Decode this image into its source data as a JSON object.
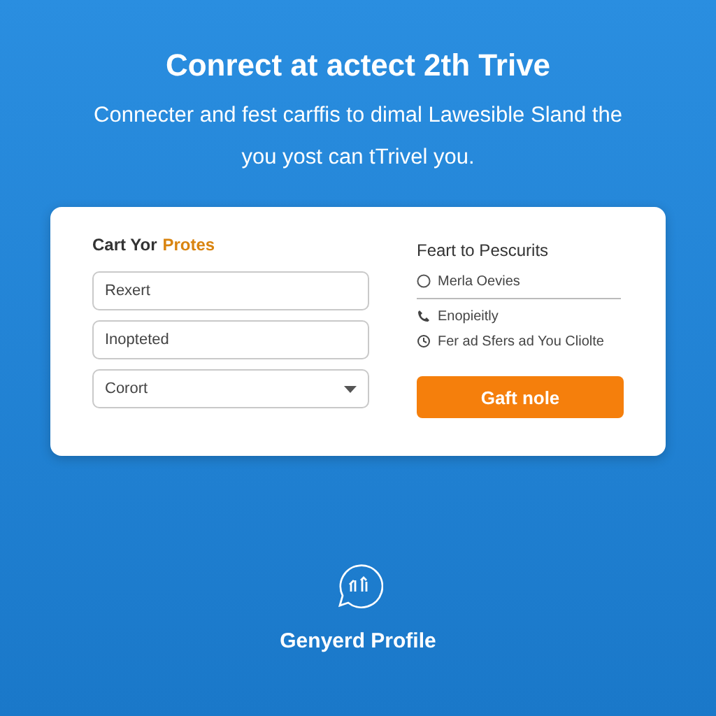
{
  "heading": "Conrect at actect 2th Trive",
  "subtitle": [
    "Connecter and fest carffis to dimal Lawesible Sland the",
    "you yost can tTrivel you."
  ],
  "form": {
    "title": "Cart Yor",
    "title_accent": "Protes",
    "fields": [
      {
        "kind": "text",
        "value": "Rexert"
      },
      {
        "kind": "text",
        "value": "Inopteted"
      },
      {
        "kind": "select",
        "value": "Corort"
      }
    ]
  },
  "side": {
    "title": "Feart to Pescurits",
    "items": [
      {
        "kind": "radio",
        "label": "Merla Oevies",
        "selected": false
      },
      {
        "kind": "phone",
        "label": "Enopieitly"
      },
      {
        "kind": "clock",
        "label": "Fer ad Sfers ad You Cliolte"
      }
    ],
    "button": "Gaft nole"
  },
  "footer": {
    "label": "Genyerd Profile"
  }
}
